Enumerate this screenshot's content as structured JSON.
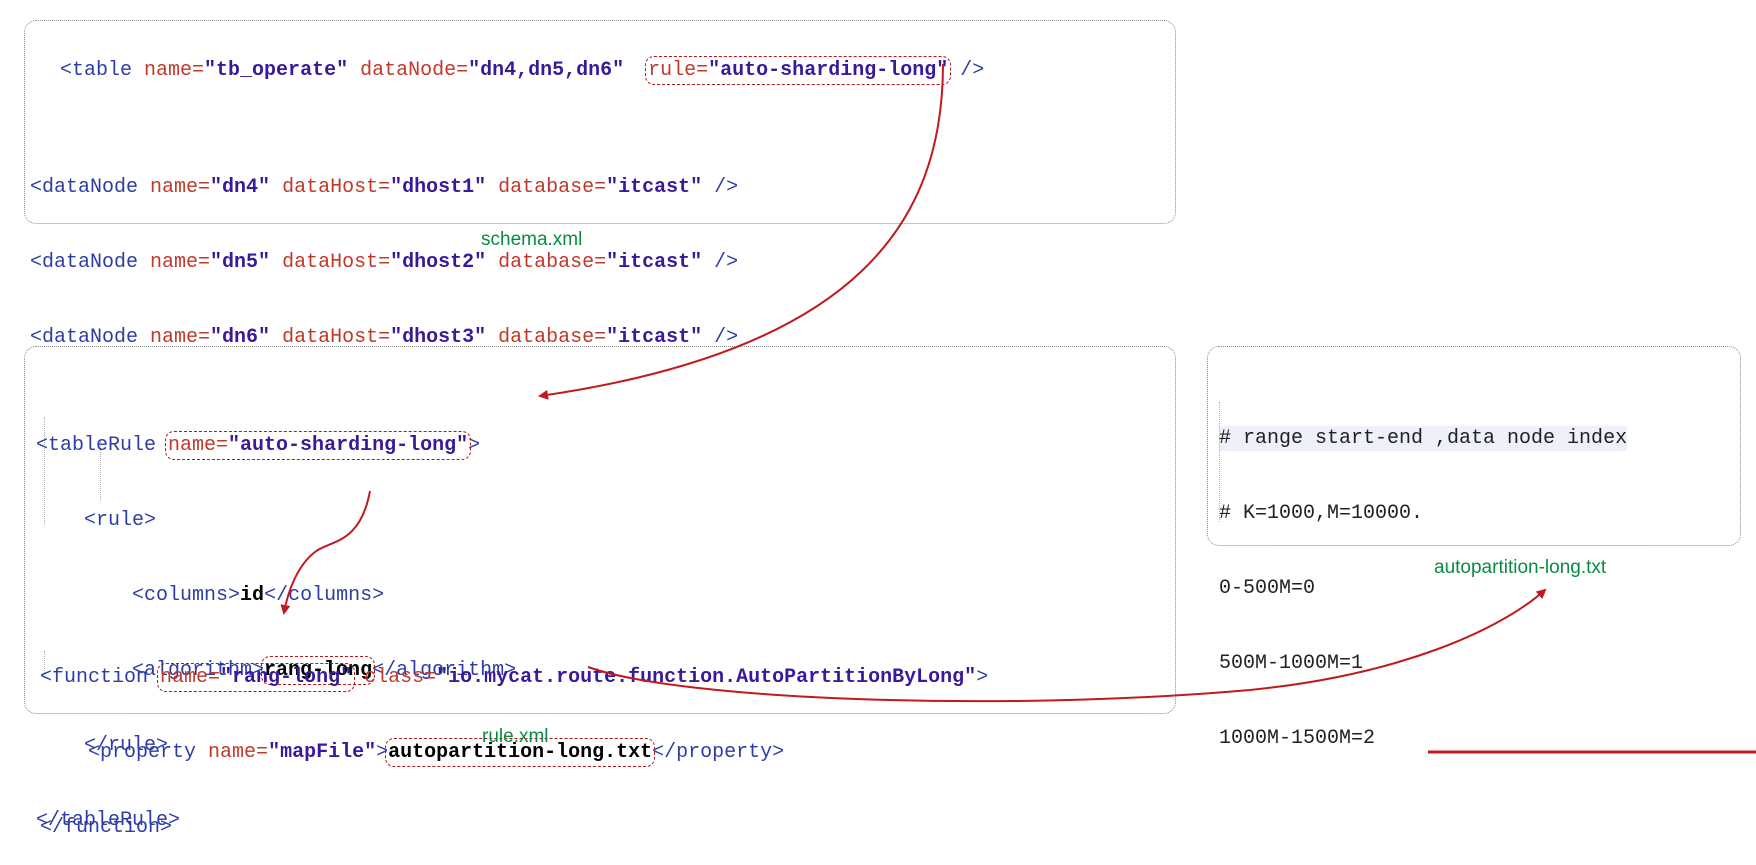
{
  "schema": {
    "caption": "schema.xml",
    "table_line": {
      "open": "<table ",
      "a1": "name=",
      "v1": "\"tb_operate\"",
      "a2": " dataNode=",
      "v2": "\"dn4,dn5,dn6\"",
      "a3": "rule=",
      "v3": "\"auto-sharding-long\"",
      "close": " />"
    },
    "datanodes": [
      {
        "open": "<dataNode ",
        "a1": "name=",
        "v1": "\"dn4\"",
        "a2": " dataHost=",
        "v2": "\"dhost1\"",
        "a3": " database=",
        "v3": "\"itcast\"",
        "close": " />"
      },
      {
        "open": "<dataNode ",
        "a1": "name=",
        "v1": "\"dn5\"",
        "a2": " dataHost=",
        "v2": "\"dhost2\"",
        "a3": " database=",
        "v3": "\"itcast\"",
        "close": " />"
      },
      {
        "open": "<dataNode ",
        "a1": "name=",
        "v1": "\"dn6\"",
        "a2": " dataHost=",
        "v2": "\"dhost3\"",
        "a3": " database=",
        "v3": "\"itcast\"",
        "close": " />"
      }
    ]
  },
  "rule": {
    "caption": "rule.xml",
    "tablerule_open": "<tableRule ",
    "tablerule_attr": "name=",
    "tablerule_val": "\"auto-sharding-long\"",
    "tablerule_gt": ">",
    "rule_open": "<rule>",
    "columns_open": "<columns>",
    "columns_text": "id",
    "columns_close": "</columns>",
    "algorithm_open": "<algorithm>",
    "algorithm_text": "rang-long",
    "algorithm_close": "</algorithm>",
    "rule_close": "</rule>",
    "tablerule_close": "</tableRule>",
    "function_open": "<function ",
    "function_attr1": "name=",
    "function_val1": "\"rang-long\"",
    "function_attr2": " class=",
    "function_val2": "\"io.mycat.route.function.AutoPartitionByLong\"",
    "function_gt": ">",
    "property_open": "<property ",
    "property_attr": "name=",
    "property_val": "\"mapFile\"",
    "property_gt": ">",
    "property_text": "autopartition-long.txt",
    "property_close": "</property>",
    "function_close": "</function>"
  },
  "autopartition": {
    "caption": "autopartition-long.txt",
    "lines": [
      "# range start-end ,data node index",
      "# K=1000,M=10000.",
      "0-500M=0",
      "500M-1000M=1",
      "1000M-1500M=2"
    ]
  },
  "colors": {
    "arrow": "#c0191f",
    "caption": "#0b8a45",
    "tag": "#2e3da6",
    "attr": "#c0392b",
    "value": "#3a1a9a"
  }
}
